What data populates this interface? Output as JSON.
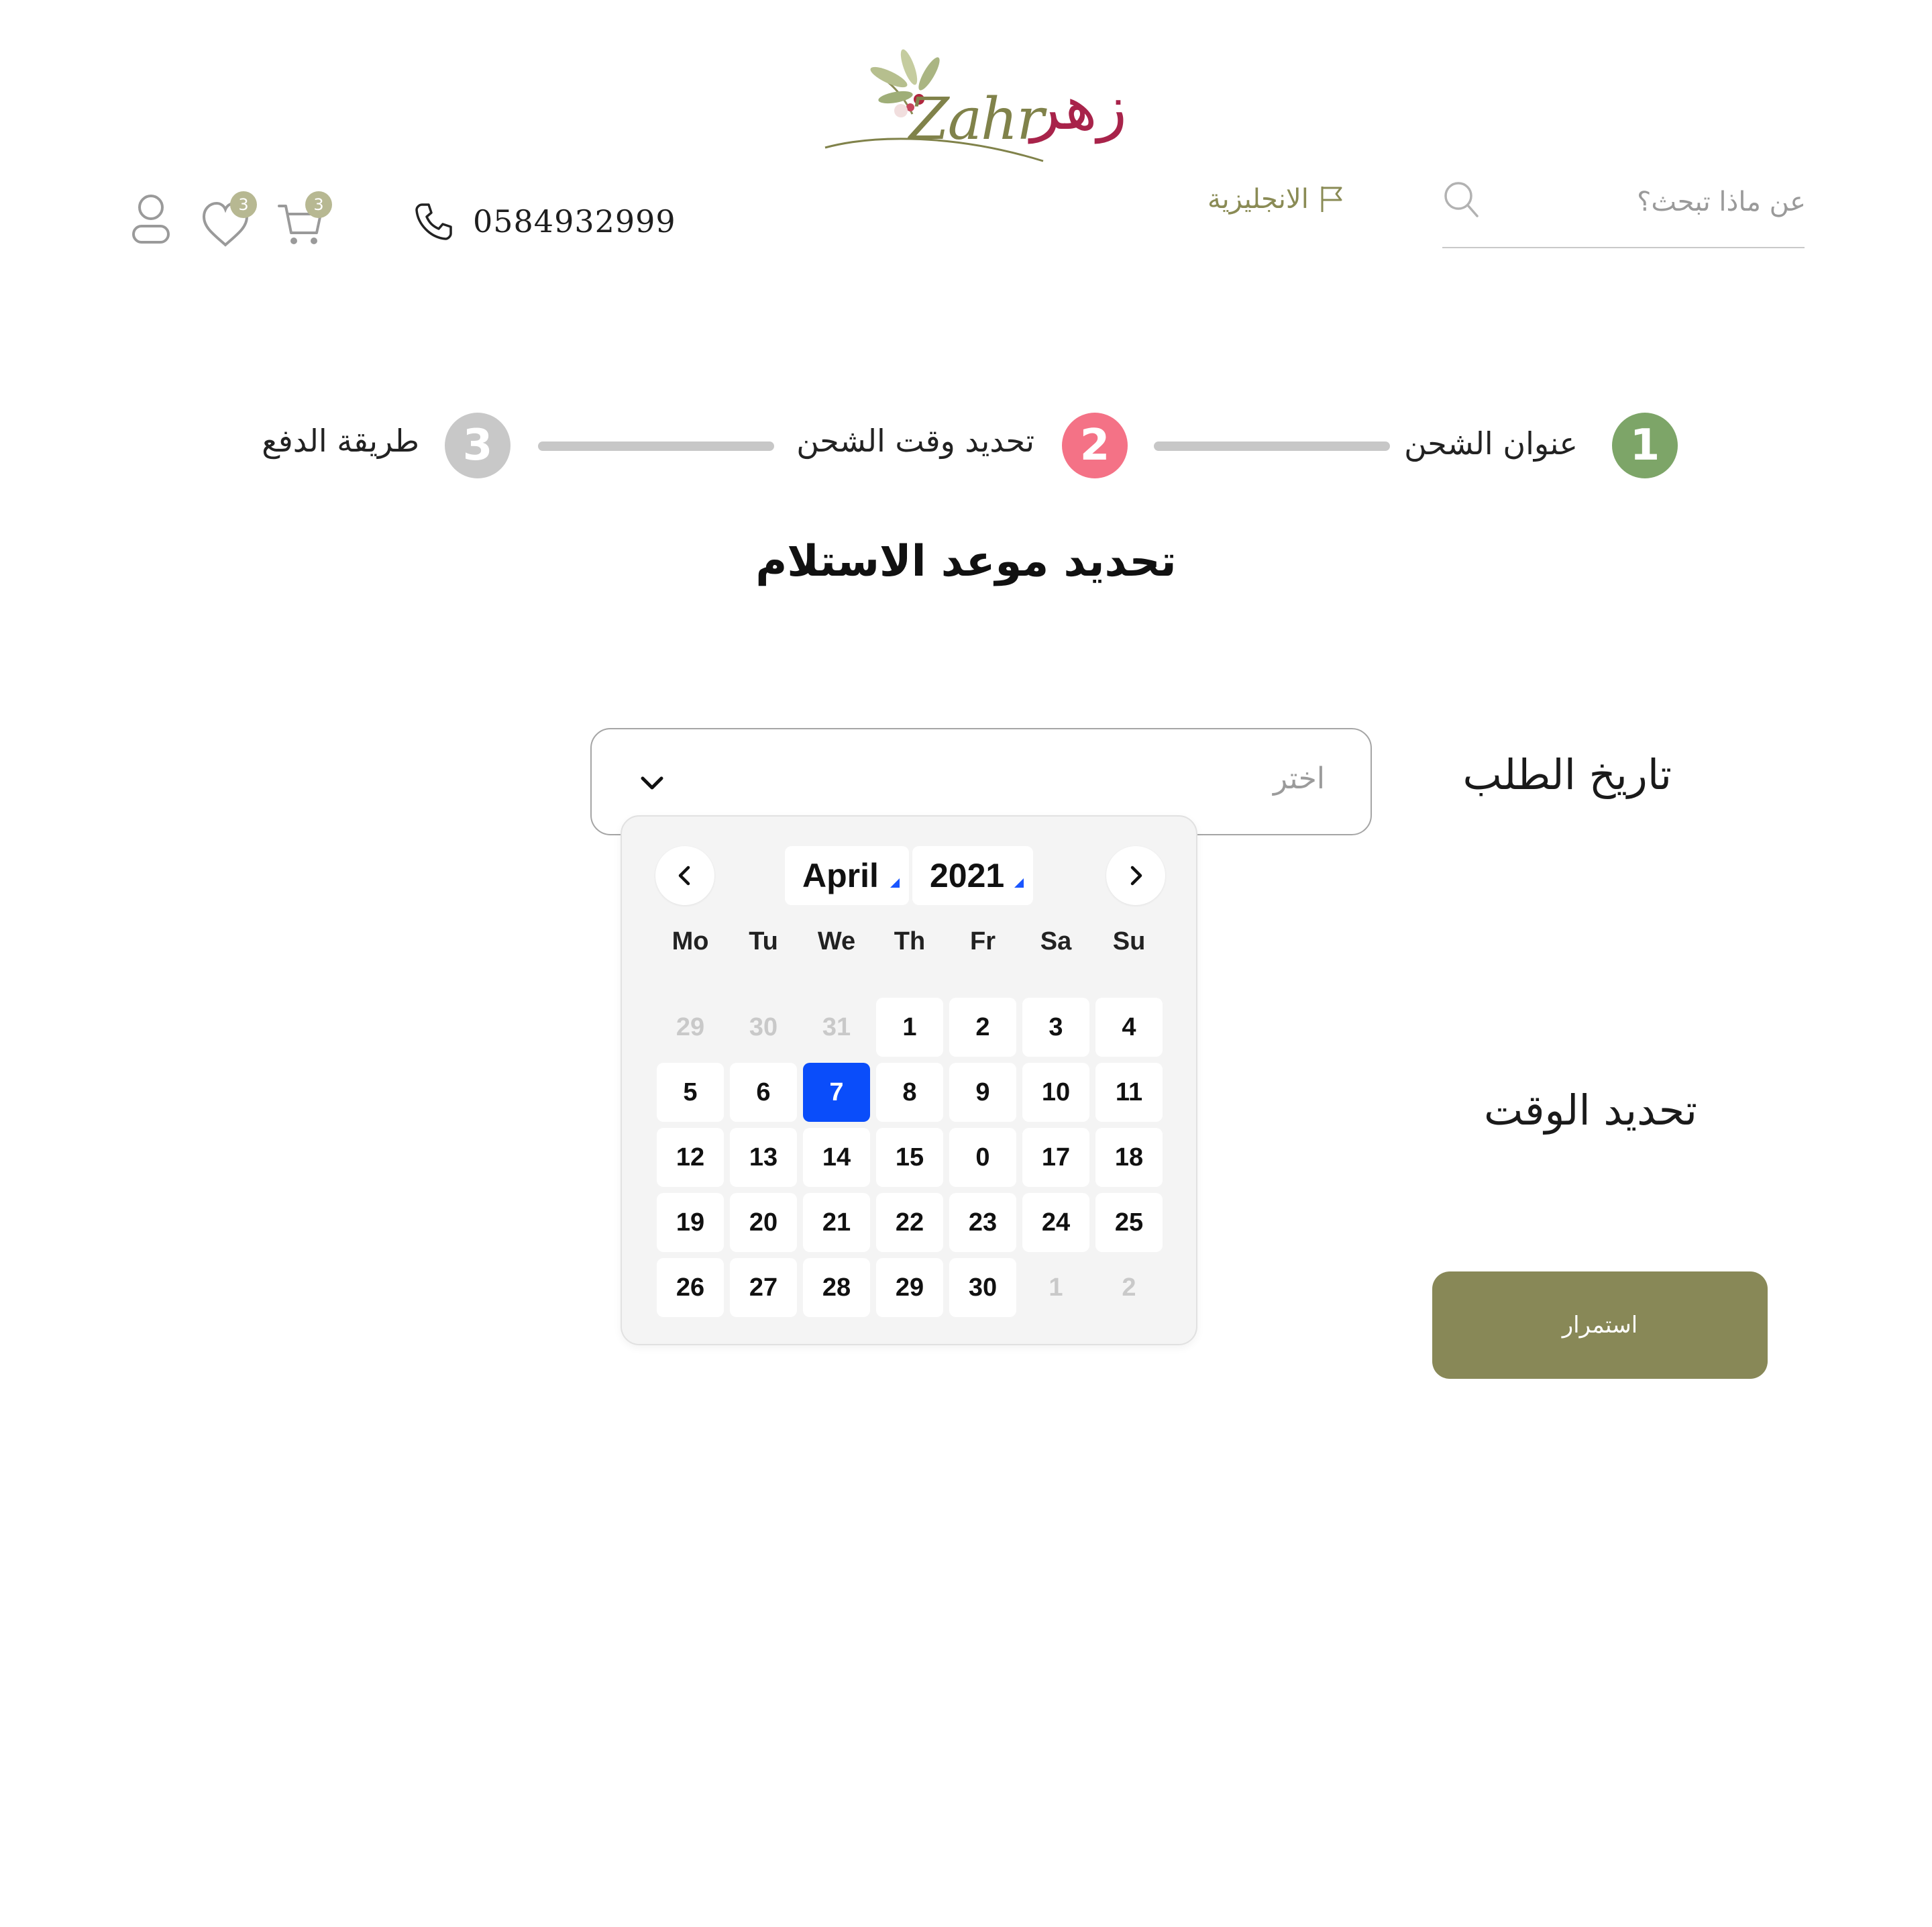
{
  "header": {
    "logo_ar": "زهر",
    "logo_en": "Zahr",
    "search_placeholder": "عن ماذا تبحث؟",
    "language_label": "الانجليزية",
    "phone": "0584932999",
    "cart_count": "3",
    "wishlist_count": "3"
  },
  "stepper": {
    "steps": [
      {
        "number": "1",
        "label": "عنوان الشحن",
        "state": "completed",
        "color": "#7da568"
      },
      {
        "number": "2",
        "label": "تحديد وقت الشحن",
        "state": "active",
        "color": "#f47286"
      },
      {
        "number": "3",
        "label": "طريقة الدفع",
        "state": "pending",
        "color": "#c8c8c8"
      }
    ]
  },
  "page_title": "تحديد موعد الاستلام",
  "form": {
    "date_label": "تاريخ الطلب",
    "date_placeholder": "اختر",
    "time_label": "تحديد الوقت",
    "continue_label": "استمرار"
  },
  "calendar": {
    "month": "April",
    "year": "2021",
    "weekdays": [
      "Mo",
      "Tu",
      "We",
      "Th",
      "Fr",
      "Sa",
      "Su"
    ],
    "days": [
      {
        "label": "29",
        "type": "other"
      },
      {
        "label": "30",
        "type": "other"
      },
      {
        "label": "31",
        "type": "other"
      },
      {
        "label": "1",
        "type": "current"
      },
      {
        "label": "2",
        "type": "current"
      },
      {
        "label": "3",
        "type": "current"
      },
      {
        "label": "4",
        "type": "current"
      },
      {
        "label": "5",
        "type": "current"
      },
      {
        "label": "6",
        "type": "current"
      },
      {
        "label": "7",
        "type": "selected"
      },
      {
        "label": "8",
        "type": "current"
      },
      {
        "label": "9",
        "type": "current"
      },
      {
        "label": "10",
        "type": "current"
      },
      {
        "label": "11",
        "type": "current"
      },
      {
        "label": "12",
        "type": "current"
      },
      {
        "label": "13",
        "type": "current"
      },
      {
        "label": "14",
        "type": "current"
      },
      {
        "label": "15",
        "type": "current"
      },
      {
        "label": "0",
        "type": "current"
      },
      {
        "label": "17",
        "type": "current"
      },
      {
        "label": "18",
        "type": "current"
      },
      {
        "label": "19",
        "type": "current"
      },
      {
        "label": "20",
        "type": "current"
      },
      {
        "label": "21",
        "type": "current"
      },
      {
        "label": "22",
        "type": "current"
      },
      {
        "label": "23",
        "type": "current"
      },
      {
        "label": "24",
        "type": "current"
      },
      {
        "label": "25",
        "type": "current"
      },
      {
        "label": "26",
        "type": "current"
      },
      {
        "label": "27",
        "type": "current"
      },
      {
        "label": "28",
        "type": "current"
      },
      {
        "label": "29",
        "type": "current"
      },
      {
        "label": "30",
        "type": "current"
      },
      {
        "label": "1",
        "type": "other"
      },
      {
        "label": "2",
        "type": "other"
      }
    ]
  },
  "icons": {
    "search": "search-icon",
    "language": "flag-icon",
    "phone": "phone-icon",
    "cart": "cart-icon",
    "wishlist": "heart-icon",
    "account": "user-icon",
    "prev_month": "chevron-left-icon",
    "next_month": "chevron-right-icon",
    "dropdown": "chevron-down-icon"
  },
  "colors": {
    "brand_olive": "#888857",
    "brand_rose": "#a8234a",
    "selected_day": "#0a4dfa"
  }
}
